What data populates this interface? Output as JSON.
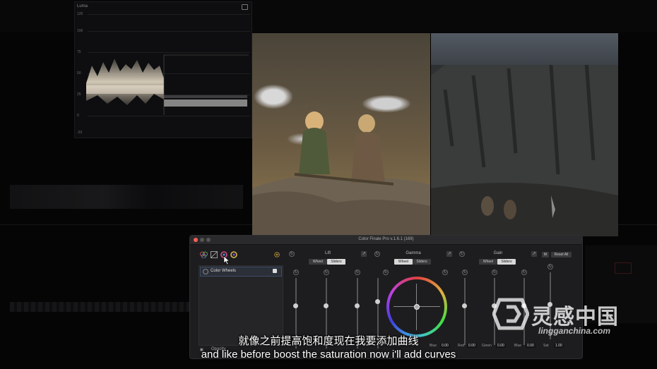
{
  "scope": {
    "title": "Luma",
    "ticks": [
      "120",
      "100",
      "75",
      "50",
      "25",
      "0",
      "-20"
    ]
  },
  "panel": {
    "title": "Color Finale Pro v.1.6.1 (169)",
    "list_item": "Color Wheels",
    "opacity_label": "Opacity",
    "lift": {
      "header": "Lift",
      "wheel_tab": "Wheel",
      "sliders_tab": "Sliders"
    },
    "gamma": {
      "header": "Gamma",
      "wheel_tab": "Wheel",
      "sliders_tab": "Sliders",
      "blue_label": "Blue",
      "blue_value": "0.00"
    },
    "gain": {
      "header": "Gain",
      "wheel_tab": "Wheel",
      "sliders_tab": "Sliders",
      "red_label": "Red",
      "red_value": "0.00",
      "green_label": "Green",
      "green_value": "0.00",
      "blue_label": "Blue",
      "blue_value": "0.00"
    },
    "m_button": "M",
    "reset_all": "Reset All",
    "sat_label": "Sat",
    "sat_value": "1.00"
  },
  "subtitles": {
    "chinese": "就像之前提高饱和度现在我要添加曲线",
    "english": "and like before boost the saturation now i'll add curves"
  },
  "watermark": {
    "brand": "灵感中国",
    "url": "lingganchina.com"
  },
  "colors": {
    "panel_bg": "#1d1d1f",
    "active_tab": "#d8d8d8",
    "close_dot": "#ff5f57"
  }
}
